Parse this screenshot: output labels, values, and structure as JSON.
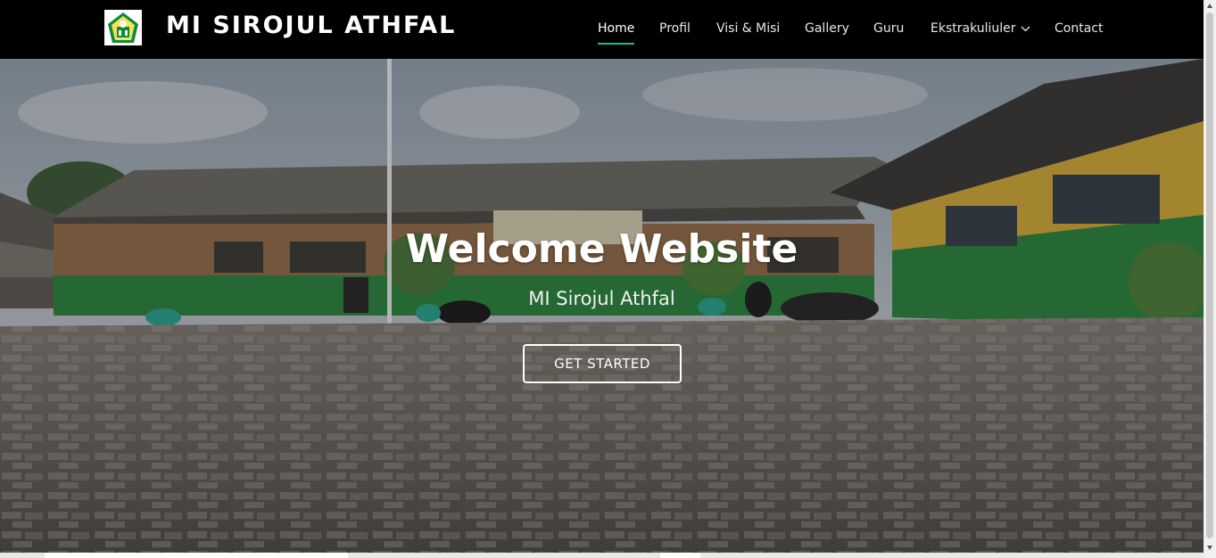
{
  "header": {
    "brand": "MI SIROJUL ATHFAL",
    "logo_icon": "school-emblem-icon",
    "background": "#000000"
  },
  "nav": {
    "items": [
      {
        "label": "Home",
        "active": true
      },
      {
        "label": "Profil",
        "active": false
      },
      {
        "label": "Visi & Misi",
        "active": false
      },
      {
        "label": "Gallery",
        "active": false
      },
      {
        "label": "Guru",
        "active": false
      },
      {
        "label": "Ekstrakuliuler",
        "active": false,
        "has_dropdown": true,
        "dropdown_icon": "chevron-down-icon"
      },
      {
        "label": "Contact",
        "active": false
      }
    ],
    "active_color": "#1bbd9c"
  },
  "hero": {
    "title": "Welcome Website",
    "subtitle": "MI Sirojul Athfal",
    "button_label": "GET STARTED",
    "background_image": "school-courtyard-photo"
  }
}
